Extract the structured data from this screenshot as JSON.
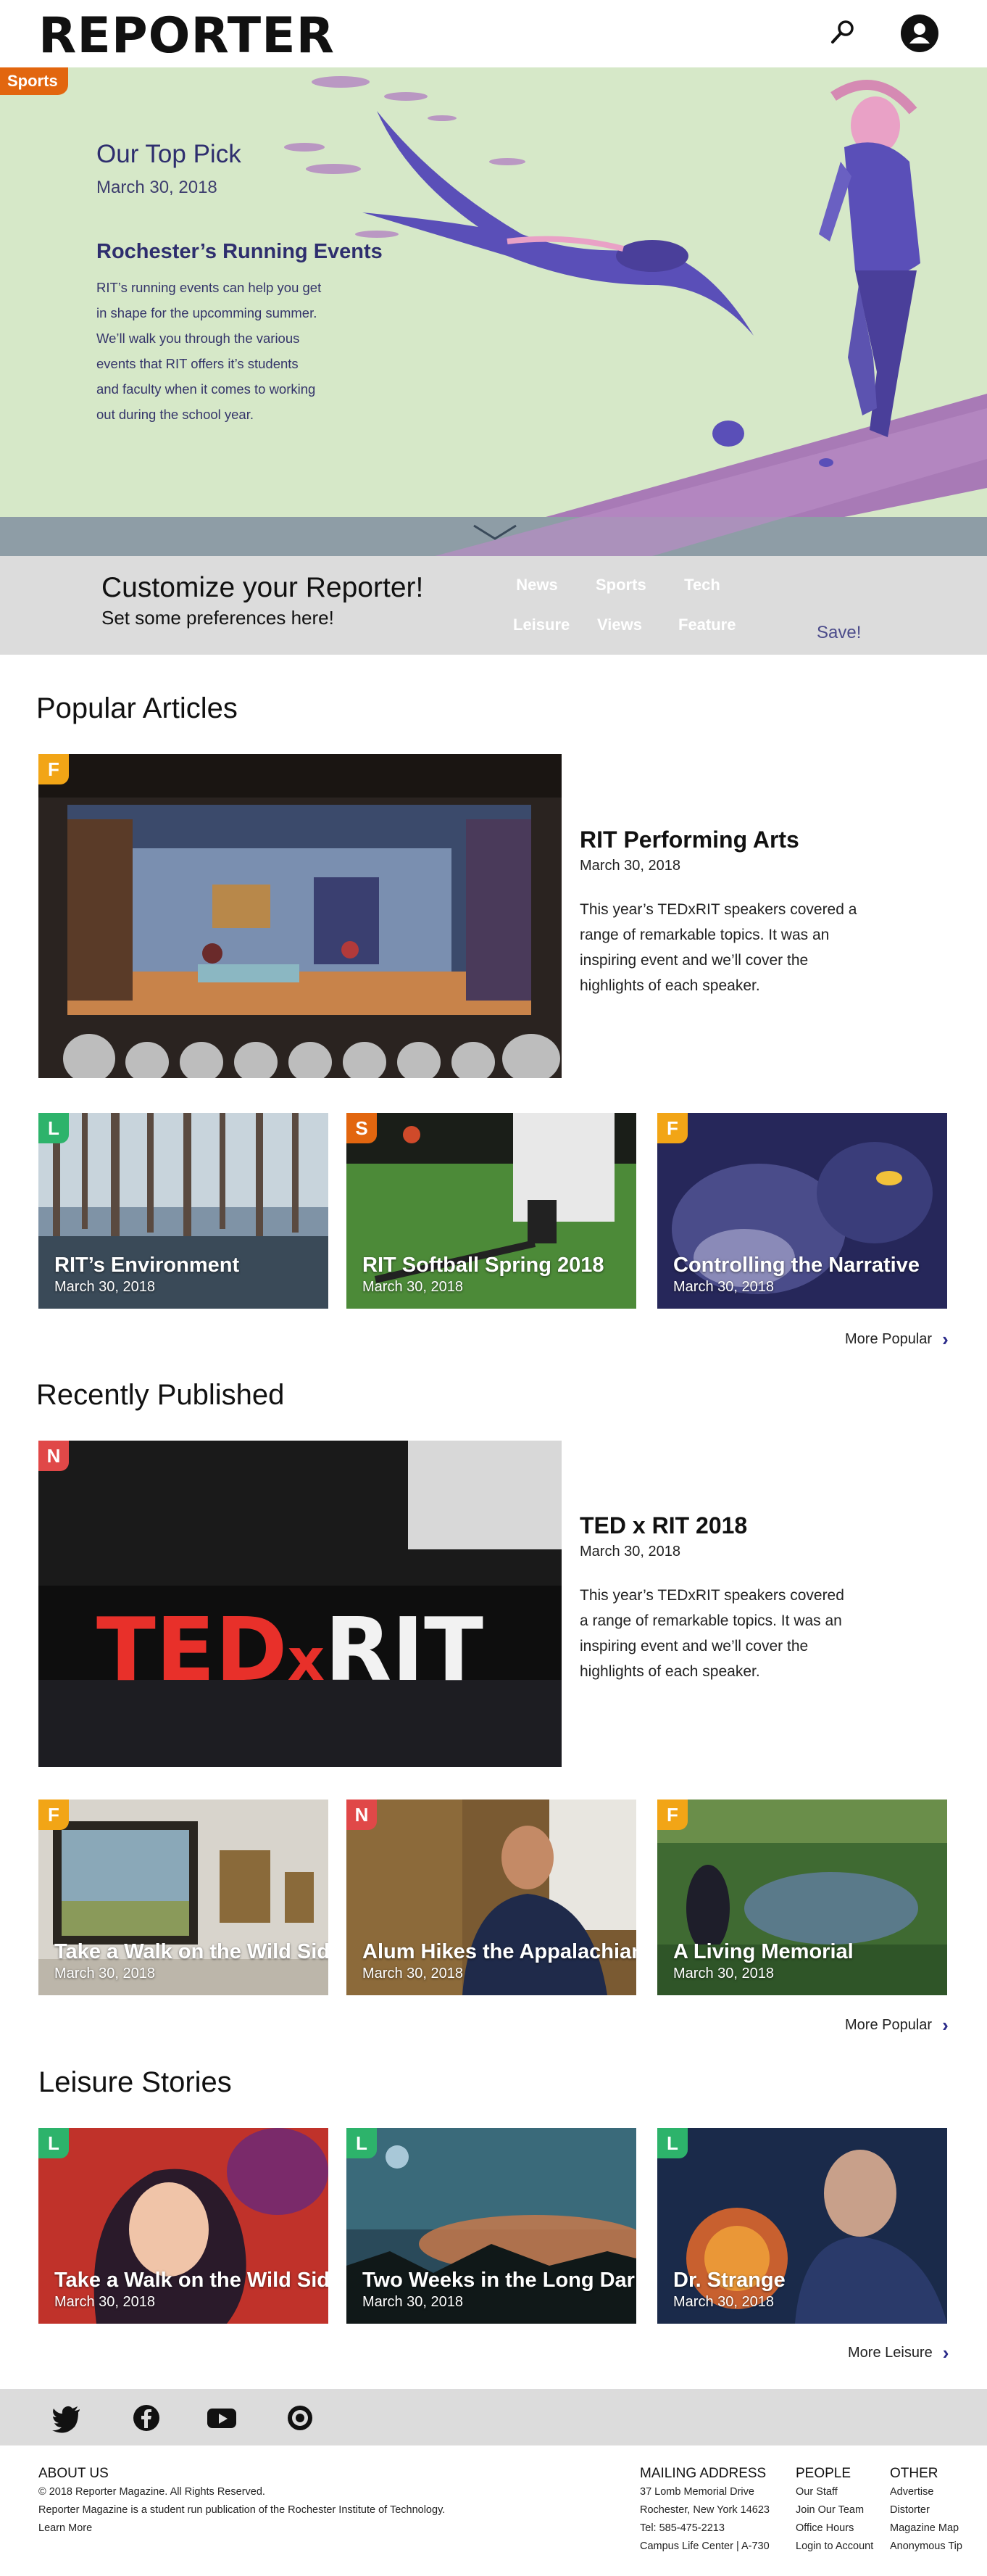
{
  "header": {
    "logo": "REPORTER",
    "search_icon": "search-icon",
    "account_icon": "user-account-icon"
  },
  "hero": {
    "category": "Sports",
    "category_color": "#e2660f",
    "kicker": "Our Top Pick",
    "date": "March 30, 2018",
    "title": "Rochester’s Running Events",
    "body_lines": [
      "RIT’s running events can help you get",
      "in shape for the upcomming summer.",
      "We’ll walk you through the various",
      "events that RIT offers it’s students",
      "and faculty when it comes to working",
      "out during the school year."
    ],
    "background_color": "#d6e8c8",
    "scroll_icon": "chevron-down-icon"
  },
  "customize": {
    "title": "Customize your Reporter!",
    "subtitle": "Set some preferences here!",
    "save_label": "Save!",
    "pills": [
      {
        "label": "News",
        "color": "#e04848"
      },
      {
        "label": "Sports",
        "color": "#e2660f"
      },
      {
        "label": "Tech",
        "color": "#2f6fe0"
      },
      {
        "label": "Leisure",
        "color": "#2db36b"
      },
      {
        "label": "Views",
        "color": "#6a2ab3"
      },
      {
        "label": "Feature",
        "color": "#f2a516"
      }
    ]
  },
  "popular": {
    "heading": "Popular Articles",
    "feature": {
      "badge": "F",
      "badge_color": "#f2a516",
      "title": "RIT Performing Arts",
      "date": "March 30, 2018",
      "body_lines": [
        "This year’s TEDxRIT speakers covered a",
        "range of remarkable topics. It was an",
        "inspiring event and we’ll cover the",
        "highlights of each speaker."
      ]
    },
    "cards": [
      {
        "badge": "L",
        "badge_color": "#2db36b",
        "title": "RIT’s Environment",
        "date": "March 30, 2018"
      },
      {
        "badge": "S",
        "badge_color": "#e2660f",
        "title": "RIT Softball Spring 2018",
        "date": "March 30, 2018"
      },
      {
        "badge": "F",
        "badge_color": "#f2a516",
        "title": "Controlling the Narrative",
        "date": "March 30, 2018"
      }
    ],
    "more_label": "More Popular"
  },
  "recent": {
    "heading": "Recently Published",
    "feature": {
      "badge": "N",
      "badge_color": "#e04848",
      "title": "TED x RIT 2018",
      "date": "March 30, 2018",
      "image_text": "TEDxRIT",
      "body_lines": [
        "This year’s TEDxRIT speakers covered",
        "a range of remarkable topics. It was an",
        "inspiring event and we’ll cover the",
        "highlights of each speaker."
      ]
    },
    "cards": [
      {
        "badge": "F",
        "badge_color": "#f2a516",
        "title": "Take a Walk on the Wild Side",
        "date": "March 30, 2018"
      },
      {
        "badge": "N",
        "badge_color": "#e04848",
        "title": "Alum Hikes the Appalachian",
        "date": "March 30, 2018"
      },
      {
        "badge": "F",
        "badge_color": "#f2a516",
        "title": "A Living Memorial",
        "date": "March 30, 2018"
      }
    ],
    "more_label": "More Popular"
  },
  "leisure": {
    "heading": "Leisure Stories",
    "cards": [
      {
        "badge": "L",
        "badge_color": "#2db36b",
        "title": "Take a Walk on the Wild Side",
        "date": "March 30, 2018"
      },
      {
        "badge": "L",
        "badge_color": "#2db36b",
        "title": "Two Weeks in the Long Dark",
        "date": "March 30, 2018"
      },
      {
        "badge": "L",
        "badge_color": "#2db36b",
        "title": "Dr. Strange",
        "date": "March 30, 2018"
      }
    ],
    "more_label": "More Leisure"
  },
  "social": {
    "icons": [
      "twitter-icon",
      "facebook-icon",
      "youtube-icon",
      "target-icon"
    ]
  },
  "footer": {
    "about": {
      "heading": "ABOUT US",
      "line1": "© 2018 Reporter Magazine. All Rights Reserved.",
      "line2": "Reporter Magazine is a student run publication of the Rochester Institute of Technology.",
      "learn_more": "Learn More"
    },
    "mailing": {
      "heading": "MAILING ADDRESS",
      "lines": [
        "37 Lomb Memorial Drive",
        "Rochester, New York 14623",
        "Tel: 585-475-2213",
        "Campus Life Center | A-730"
      ]
    },
    "people": {
      "heading": "PEOPLE",
      "links": [
        "Our Staff",
        "Join Our Team",
        "Office Hours",
        "Login to Account"
      ]
    },
    "other": {
      "heading": "OTHER",
      "links": [
        "Advertise",
        "Distorter",
        "Magazine Map",
        "Anonymous Tip"
      ]
    }
  }
}
